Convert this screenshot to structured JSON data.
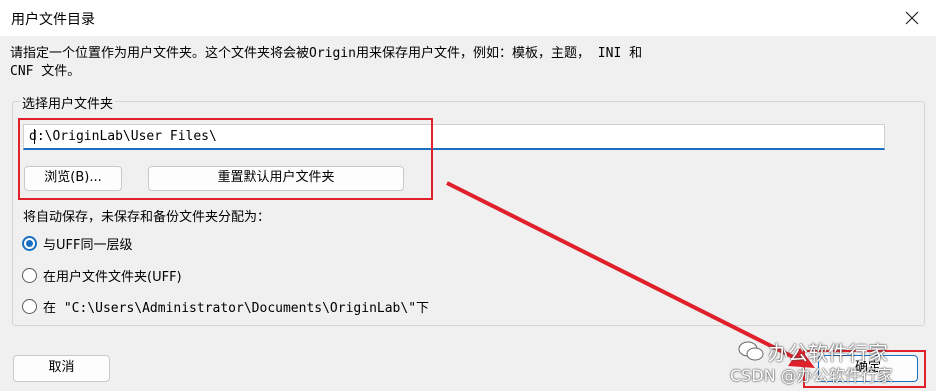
{
  "window": {
    "title": "用户文件目录",
    "close_icon": "close-icon"
  },
  "description": "请指定一个位置作为用户文件夹。这个文件夹将会被Origin用来保存用户文件，例如：模板，主题， INI 和 CNF 文件。",
  "group": {
    "legend": "选择用户文件夹",
    "path_value": "d:\\OriginLab\\User Files\\",
    "browse_label": "浏览(B)...",
    "reset_label": "重置默认用户文件夹"
  },
  "autosave": {
    "label": "将自动保存，未保存和备份文件夹分配为：",
    "options": [
      {
        "label": "与UFF同一层级",
        "checked": true
      },
      {
        "label": "在用户文件文件夹(UFF)",
        "checked": false
      },
      {
        "label": "在 \"C:\\Users\\Administrator\\Documents\\OriginLab\\\"下",
        "checked": false
      }
    ]
  },
  "buttons": {
    "cancel": "取消",
    "ok": "确定"
  },
  "watermark": {
    "line1": "办公软件行家",
    "line2": "CSDN @办公软件行家"
  },
  "colors": {
    "accent": "#1a6fc2",
    "annotation": "#e0202a"
  }
}
